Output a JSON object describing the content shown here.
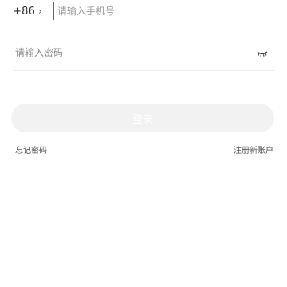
{
  "phone": {
    "country_code": "+86",
    "chevron": "›",
    "placeholder": "请输入手机号",
    "value": ""
  },
  "password": {
    "placeholder": "请输入密码",
    "value": "",
    "toggle_icon": "eye-closed-icon"
  },
  "login_button": {
    "label": "登录",
    "background": "#f2f2f2",
    "text_color": "#ffffff"
  },
  "links": {
    "forgot_password": "忘记密码",
    "register": "注册新账户"
  }
}
